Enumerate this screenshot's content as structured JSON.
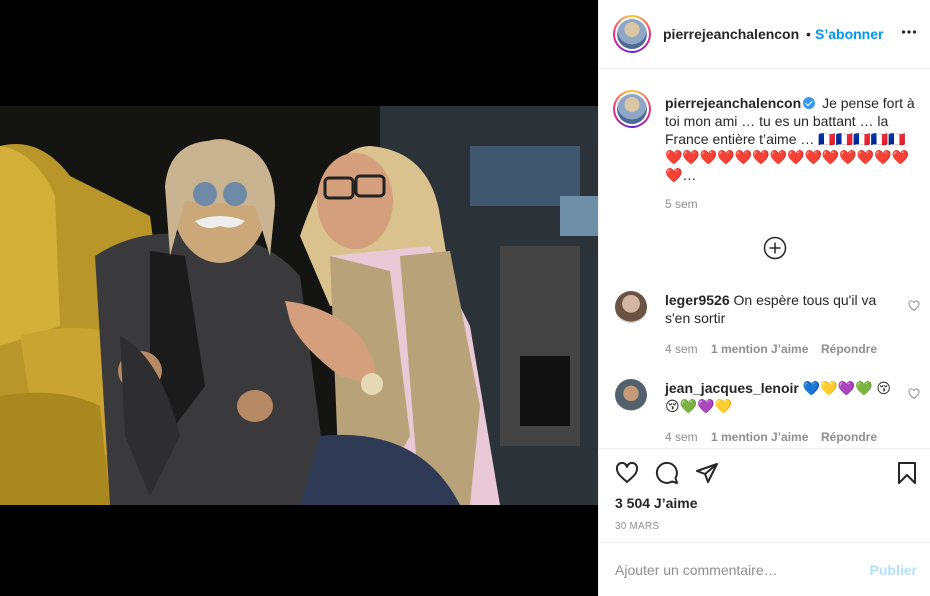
{
  "post": {
    "username": "pierrejeanchalencon",
    "follow_label": "S’abonner",
    "separator": "•",
    "caption": "Je pense fort à toi mon ami … tu es un battant … la France entière t’aime … 🇫🇷🇫🇷🇫🇷🇫🇷🇫🇷 ❤️❤️❤️❤️❤️❤️❤️❤️❤️❤️❤️❤️❤️❤️❤️…",
    "caption_age": "5 sem",
    "likes": "3 504 J’aime",
    "date": "30 MARS"
  },
  "comments": [
    {
      "username": "leger9526",
      "text": "On espère tous qu'il va s'en sortir",
      "age": "4 sem",
      "likes": "1 mention J’aime",
      "reply": "Répondre"
    },
    {
      "username": "jean_jacques_lenoir",
      "text": "💙💛💜💚 😚😚💚💜💛",
      "age": "4 sem",
      "likes": "1 mention J’aime",
      "reply": "Répondre"
    }
  ],
  "composer": {
    "placeholder": "Ajouter un commentaire…",
    "publish_label": "Publier"
  },
  "icons": {
    "more": "more-options-icon",
    "load_more": "plus-circle-icon",
    "like": "heart-icon",
    "comment": "comment-icon",
    "share": "share-icon",
    "save": "bookmark-icon"
  },
  "colors": {
    "accent": "#0095f6",
    "verified": "#3897f0",
    "muted": "#8e8e8e",
    "publish_disabled": "#b2dffc"
  }
}
